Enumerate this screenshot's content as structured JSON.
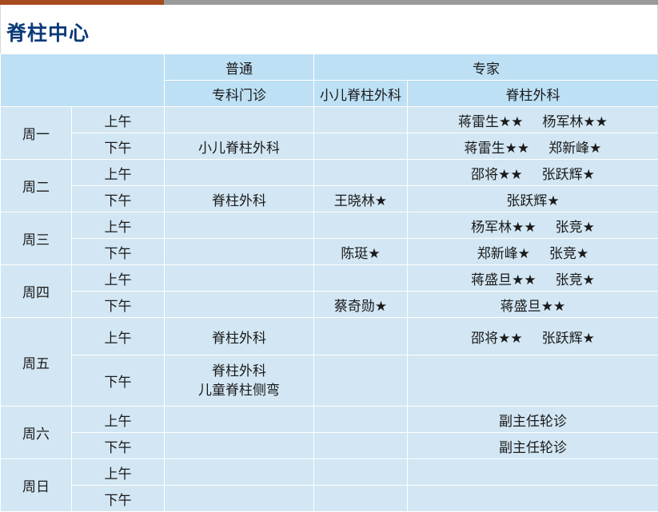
{
  "page": {
    "title": "脊柱中心"
  },
  "header": {
    "group_regular": "普通",
    "group_expert": "专家",
    "sub_clinic": "专科门诊",
    "sub_peds": "小儿脊柱外科",
    "sub_spine": "脊柱外科"
  },
  "schedule": {
    "mon": {
      "day": "周一",
      "am": {
        "session": "上午",
        "regular": "",
        "peds": "",
        "experts": [
          "蒋雷生★★",
          "杨军林★★"
        ]
      },
      "pm": {
        "session": "下午",
        "regular": "小儿脊柱外科",
        "peds": "",
        "experts": [
          "蒋雷生★★",
          "郑新峰★"
        ]
      }
    },
    "tue": {
      "day": "周二",
      "am": {
        "session": "上午",
        "regular": "",
        "peds": "",
        "experts": [
          "邵将★★",
          "张跃辉★"
        ]
      },
      "pm": {
        "session": "下午",
        "regular": "脊柱外科",
        "peds": "王晓林★",
        "experts": [
          "张跃辉★"
        ]
      }
    },
    "wed": {
      "day": "周三",
      "am": {
        "session": "上午",
        "regular": "",
        "peds": "",
        "experts": [
          "杨军林★★",
          "张竞★"
        ]
      },
      "pm": {
        "session": "下午",
        "regular": "",
        "peds": "陈珽★",
        "experts": [
          "郑新峰★",
          "张竞★"
        ]
      }
    },
    "thu": {
      "day": "周四",
      "am": {
        "session": "上午",
        "regular": "",
        "peds": "",
        "experts": [
          "蒋盛旦★★",
          "张竞★"
        ]
      },
      "pm": {
        "session": "下午",
        "regular": "",
        "peds": "蔡奇勋★",
        "experts": [
          "蒋盛旦★★"
        ]
      }
    },
    "fri": {
      "day": "周五",
      "am": {
        "session": "上午",
        "regular": "脊柱外科",
        "peds": "",
        "experts": [
          "邵将★★",
          "张跃辉★"
        ]
      },
      "pm": {
        "session": "下午",
        "regular": [
          "脊柱外科",
          "儿童脊柱侧弯"
        ],
        "peds": "",
        "experts": []
      }
    },
    "sat": {
      "day": "周六",
      "am": {
        "session": "上午",
        "regular": "",
        "peds": "",
        "expert_text": "副主任轮诊"
      },
      "pm": {
        "session": "下午",
        "regular": "",
        "peds": "",
        "expert_text": "副主任轮诊"
      }
    },
    "sun": {
      "day": "周日",
      "am": {
        "session": "上午",
        "regular": "",
        "peds": "",
        "expert_text": ""
      },
      "pm": {
        "session": "下午",
        "regular": "",
        "peds": "",
        "expert_text": ""
      }
    }
  }
}
